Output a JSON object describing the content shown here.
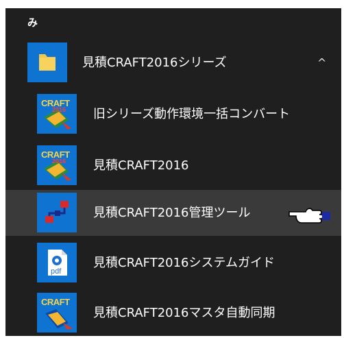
{
  "section": {
    "letter": "み"
  },
  "folder": {
    "label": "見積CRAFT2016シリーズ",
    "icon": "folder-icon",
    "chevron": "^",
    "expanded": true
  },
  "items": [
    {
      "label": "旧シリーズ動作環境一括コンバート",
      "icon": "craft-converter-icon",
      "icon_text": "CRAFT",
      "icon_year": "2016"
    },
    {
      "label": "見積CRAFT2016",
      "icon": "craft-app-icon",
      "icon_text": "CRAFT",
      "icon_year": "2016"
    },
    {
      "label": "見積CRAFT2016管理ツール",
      "icon": "admin-tool-icon",
      "hovered": true
    },
    {
      "label": "見積CRAFT2016システムガイド",
      "icon": "pdf-guide-icon",
      "icon_text": "pdf"
    },
    {
      "label": "見積CRAFT2016マスタ自動同期",
      "icon": "craft-sync-icon",
      "icon_text": "CRAFT"
    }
  ],
  "colors": {
    "menu_background": "#1f1f1f",
    "tile_blue": "#0f73d1",
    "hover_background": "#3a3a3a",
    "folder_yellow": "#f3c54a",
    "text": "#ffffff"
  }
}
